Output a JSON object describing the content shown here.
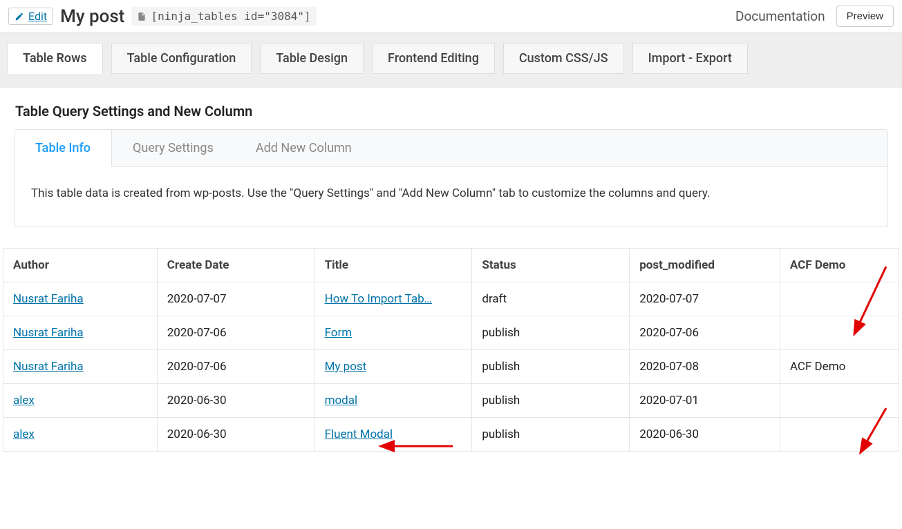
{
  "header": {
    "edit_label": "Edit",
    "title": "My post",
    "shortcode": "[ninja_tables id=\"3084\"]",
    "documentation_label": "Documentation",
    "preview_label": "Preview"
  },
  "main_tabs": [
    {
      "label": "Table Rows",
      "active": true
    },
    {
      "label": "Table Configuration",
      "active": false
    },
    {
      "label": "Table Design",
      "active": false
    },
    {
      "label": "Frontend Editing",
      "active": false
    },
    {
      "label": "Custom CSS/JS",
      "active": false
    },
    {
      "label": "Import - Export",
      "active": false
    }
  ],
  "section": {
    "title": "Table Query Settings and New Column",
    "sub_tabs": [
      {
        "label": "Table Info",
        "active": true
      },
      {
        "label": "Query Settings",
        "active": false
      },
      {
        "label": "Add New Column",
        "active": false
      }
    ],
    "info_text": "This table data is created from wp-posts. Use the \"Query Settings\" and \"Add New Column\" tab to customize the columns and query."
  },
  "table": {
    "headers": [
      "Author",
      "Create Date",
      "Title",
      "Status",
      "post_modified",
      "ACF Demo"
    ],
    "rows": [
      {
        "author": "Nusrat Fariha",
        "create_date": "2020-07-07",
        "title": "How To Import Tab…",
        "status": "draft",
        "post_modified": "2020-07-07",
        "acf_demo": ""
      },
      {
        "author": "Nusrat Fariha",
        "create_date": "2020-07-06",
        "title": "Form",
        "status": "publish",
        "post_modified": "2020-07-06",
        "acf_demo": ""
      },
      {
        "author": "Nusrat Fariha",
        "create_date": "2020-07-06",
        "title": "My post",
        "status": "publish",
        "post_modified": "2020-07-08",
        "acf_demo": "ACF Demo"
      },
      {
        "author": "alex",
        "create_date": "2020-06-30",
        "title": "modal",
        "status": "publish",
        "post_modified": "2020-07-01",
        "acf_demo": ""
      },
      {
        "author": "alex",
        "create_date": "2020-06-30",
        "title": "Fluent Modal",
        "status": "publish",
        "post_modified": "2020-06-30",
        "acf_demo": ""
      }
    ]
  }
}
